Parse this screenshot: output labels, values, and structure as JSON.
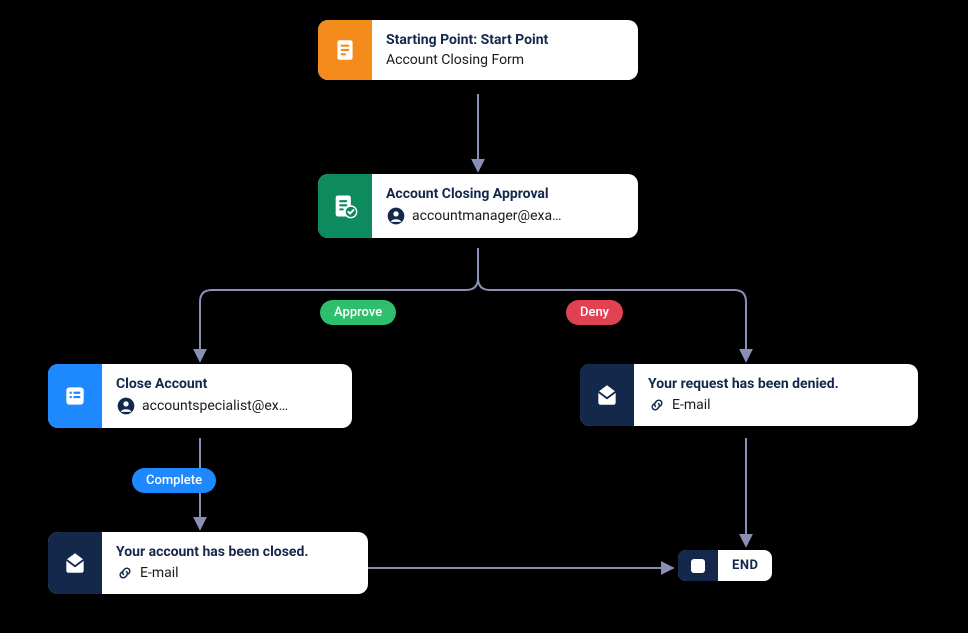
{
  "nodes": {
    "start": {
      "title": "Starting Point: Start Point",
      "subtitle": "Account Closing Form",
      "iconBg": "#f48c1c"
    },
    "approval": {
      "title": "Account Closing Approval",
      "subtitle": "accountmanager@exa…",
      "iconBg": "#0d8a5e"
    },
    "close": {
      "title": "Close Account",
      "subtitle": "accountspecialist@ex…",
      "iconBg": "#1e88ff"
    },
    "denied": {
      "title": "Your request has been denied.",
      "subtitle": "E-mail",
      "iconBg": "#13284b"
    },
    "closed": {
      "title": "Your account has been closed.",
      "subtitle": "E-mail",
      "iconBg": "#13284b"
    },
    "end": {
      "label": "END"
    }
  },
  "pills": {
    "approve": {
      "label": "Approve",
      "bg": "#2dbf6b"
    },
    "deny": {
      "label": "Deny",
      "bg": "#e04252"
    },
    "complete": {
      "label": "Complete",
      "bg": "#1e88ff"
    }
  },
  "colors": {
    "connector": "#8a8fb8",
    "arrow": "#8a8fb8"
  }
}
